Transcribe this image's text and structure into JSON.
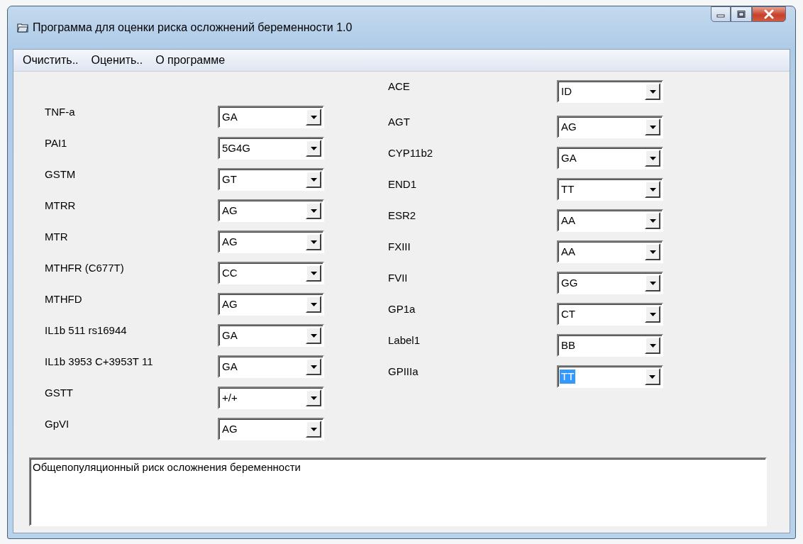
{
  "window": {
    "title": "Программа для оценки риска осложнений беременности 1.0"
  },
  "menu": [
    "Очистить..",
    "Оценить..",
    "О программе"
  ],
  "left_genes": [
    {
      "label": "TNF-a",
      "value": "GA"
    },
    {
      "label": "PAI1",
      "value": "5G4G"
    },
    {
      "label": "GSTM",
      "value": "GT"
    },
    {
      "label": "MTRR",
      "value": "AG"
    },
    {
      "label": "MTR",
      "value": "AG"
    },
    {
      "label": "MTHFR (C677T)",
      "value": "CC"
    },
    {
      "label": "MTHFD",
      "value": "AG"
    },
    {
      "label": "IL1b 511 rs16944",
      "value": "GA"
    },
    {
      "label": "IL1b 3953 C+3953T 11",
      "value": "GA"
    },
    {
      "label": "GSTT",
      "value": "+/+"
    },
    {
      "label": "GpVI",
      "value": "AG"
    }
  ],
  "right_genes": [
    {
      "label": "ACE",
      "value": "ID",
      "text_selected": false
    },
    {
      "label": "AGT",
      "value": "AG",
      "text_selected": false
    },
    {
      "label": "CYP11b2",
      "value": "GA",
      "text_selected": false
    },
    {
      "label": "END1",
      "value": "TT",
      "text_selected": false
    },
    {
      "label": "ESR2",
      "value": "AA",
      "text_selected": false
    },
    {
      "label": "FXIII",
      "value": "AA",
      "text_selected": false
    },
    {
      "label": "FVII",
      "value": "GG",
      "text_selected": false
    },
    {
      "label": "GP1a",
      "value": "CT",
      "text_selected": false
    },
    {
      "label": "Label1",
      "value": "BB",
      "text_selected": false
    },
    {
      "label": "GPIIIa",
      "value": "TT",
      "text_selected": true
    }
  ],
  "result": {
    "text": "Общепопуляционный риск осложнения беременности"
  }
}
